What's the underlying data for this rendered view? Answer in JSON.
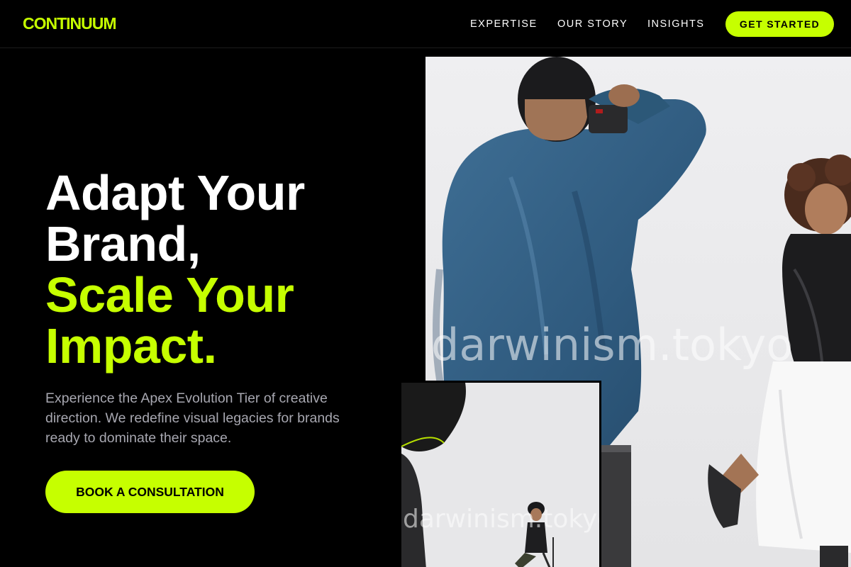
{
  "brand": {
    "logo": "CONTINUUM",
    "accent": "#c6ff00"
  },
  "nav": {
    "links": [
      "EXPERTISE",
      "OUR STORY",
      "INSIGHTS"
    ],
    "cta": "GET STARTED"
  },
  "hero": {
    "headline": [
      "Adapt Your",
      "Brand,"
    ],
    "headline_accent": [
      "Scale Your",
      "Impact."
    ],
    "subtext": "Experience the Apex Evolution Tier of creative direction. We redefine visual legacies for brands ready to dominate their space.",
    "cta": "BOOK A CONSULTATION"
  },
  "images": {
    "main_watermark": "darwinism.tokyo",
    "inset_watermark": "darwinism.tokyo"
  }
}
